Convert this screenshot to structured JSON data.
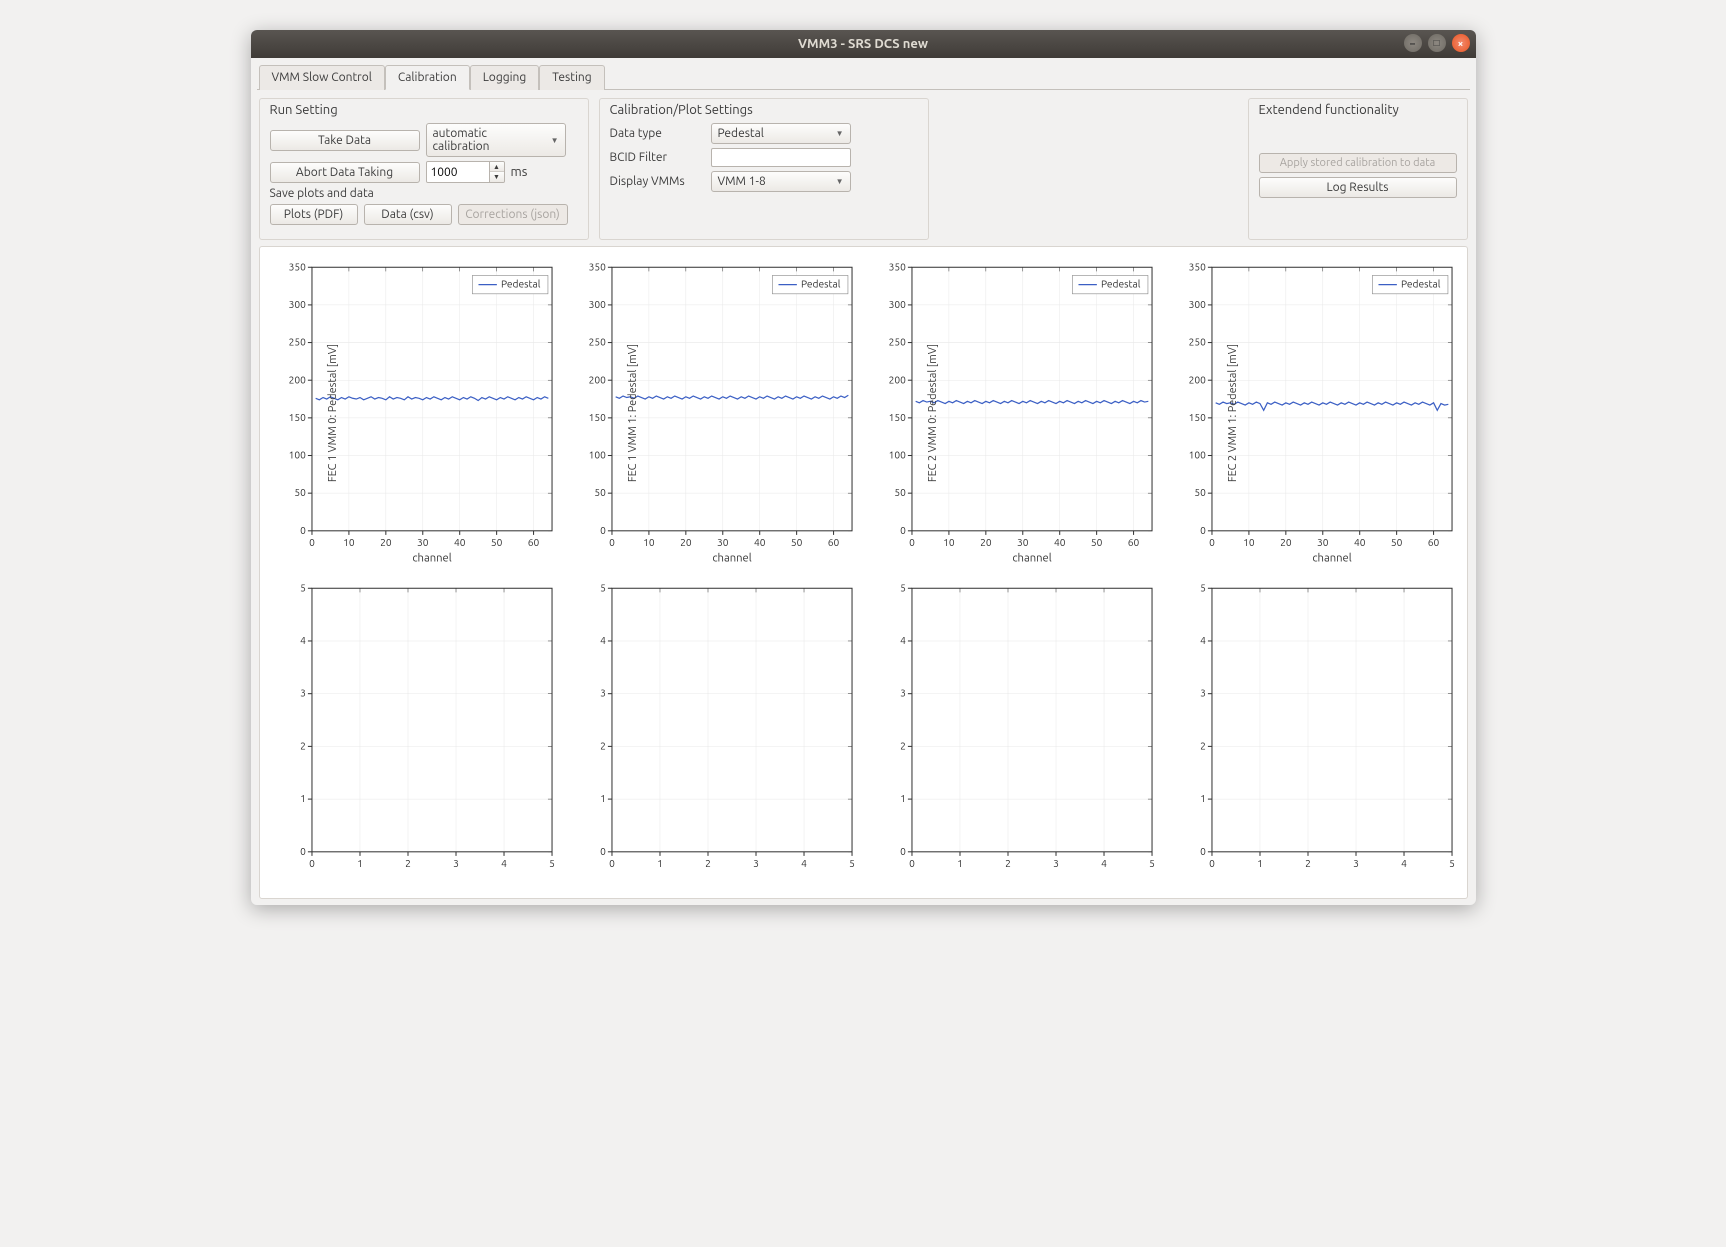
{
  "window": {
    "title": "VMM3 - SRS DCS new"
  },
  "tabs": [
    "VMM Slow Control",
    "Calibration",
    "Logging",
    "Testing"
  ],
  "active_tab": "Calibration",
  "run_setting": {
    "title": "Run Setting",
    "take_data": "Take Data",
    "calib_mode": "automatic calibration",
    "abort": "Abort Data Taking",
    "timeout_value": "1000",
    "timeout_unit": "ms",
    "save_label": "Save plots and data",
    "plots_pdf": "Plots (PDF)",
    "data_csv": "Data (csv)",
    "corrections": "Corrections (json)"
  },
  "calib_settings": {
    "title": "Calibration/Plot Settings",
    "data_type_label": "Data type",
    "data_type_value": "Pedestal",
    "bcid_label": "BCID Filter",
    "bcid_value": "",
    "display_label": "Display VMMs",
    "display_value": "VMM 1-8"
  },
  "extended": {
    "title": "Extendend functionality",
    "apply": "Apply stored calibration to data",
    "log": "Log Results"
  },
  "chart_data": {
    "top_row": {
      "type": "line",
      "xlabel": "channel",
      "xlim": [
        0,
        65
      ],
      "ylim": [
        0,
        350
      ],
      "xticks": [
        0,
        10,
        20,
        30,
        40,
        50,
        60
      ],
      "yticks": [
        0,
        50,
        100,
        150,
        200,
        250,
        300,
        350
      ],
      "legend": "Pedestal",
      "charts": [
        {
          "ylabel": "FEC 1 VMM 0: Pedestal [mV]",
          "values": [
            176,
            174,
            177,
            175,
            178,
            176,
            174,
            177,
            175,
            178,
            176,
            175,
            177,
            174,
            176,
            178,
            175,
            177,
            176,
            174,
            178,
            175,
            177,
            176,
            174,
            178,
            175,
            177,
            176,
            174,
            177,
            175,
            178,
            176,
            174,
            177,
            175,
            178,
            176,
            174,
            177,
            175,
            178,
            176,
            173,
            177,
            175,
            178,
            176,
            174,
            177,
            175,
            178,
            176,
            174,
            177,
            175,
            178,
            176,
            174,
            177,
            175,
            178,
            176
          ]
        },
        {
          "ylabel": "FEC 1 VMM 1: Pedestal [mV]",
          "values": [
            178,
            176,
            179,
            177,
            178,
            176,
            179,
            177,
            175,
            178,
            176,
            179,
            177,
            175,
            178,
            176,
            179,
            177,
            175,
            178,
            176,
            179,
            177,
            175,
            178,
            176,
            179,
            177,
            175,
            178,
            176,
            179,
            177,
            175,
            178,
            176,
            179,
            177,
            175,
            178,
            176,
            179,
            177,
            175,
            178,
            176,
            179,
            177,
            175,
            178,
            176,
            179,
            177,
            175,
            178,
            176,
            179,
            177,
            175,
            178,
            176,
            179,
            177,
            180
          ]
        },
        {
          "ylabel": "FEC 2 VMM 0: Pedestal [mV]",
          "values": [
            172,
            170,
            173,
            171,
            172,
            170,
            173,
            171,
            169,
            172,
            170,
            173,
            171,
            169,
            172,
            170,
            173,
            171,
            169,
            172,
            170,
            173,
            171,
            169,
            172,
            170,
            173,
            171,
            169,
            172,
            170,
            173,
            171,
            169,
            172,
            170,
            173,
            171,
            169,
            172,
            170,
            173,
            171,
            169,
            172,
            170,
            173,
            171,
            169,
            172,
            170,
            173,
            171,
            169,
            172,
            170,
            173,
            171,
            169,
            172,
            170,
            173,
            171,
            172
          ]
        },
        {
          "ylabel": "FEC 2 VMM 1: Pedestal [mV]",
          "values": [
            170,
            168,
            171,
            169,
            170,
            168,
            171,
            169,
            167,
            170,
            168,
            171,
            169,
            160,
            170,
            168,
            171,
            169,
            167,
            170,
            168,
            171,
            169,
            167,
            170,
            168,
            171,
            169,
            167,
            170,
            168,
            171,
            169,
            167,
            170,
            168,
            171,
            169,
            167,
            170,
            168,
            171,
            169,
            167,
            170,
            168,
            171,
            169,
            167,
            170,
            168,
            171,
            169,
            167,
            170,
            168,
            171,
            169,
            167,
            170,
            160,
            169,
            167,
            168
          ]
        }
      ]
    },
    "bottom_row": {
      "type": "line",
      "xlim": [
        0,
        5
      ],
      "ylim": [
        0,
        5
      ],
      "xticks": [
        0,
        1,
        2,
        3,
        4,
        5
      ],
      "yticks": [
        0,
        1,
        2,
        3,
        4,
        5
      ],
      "count": 4
    }
  }
}
